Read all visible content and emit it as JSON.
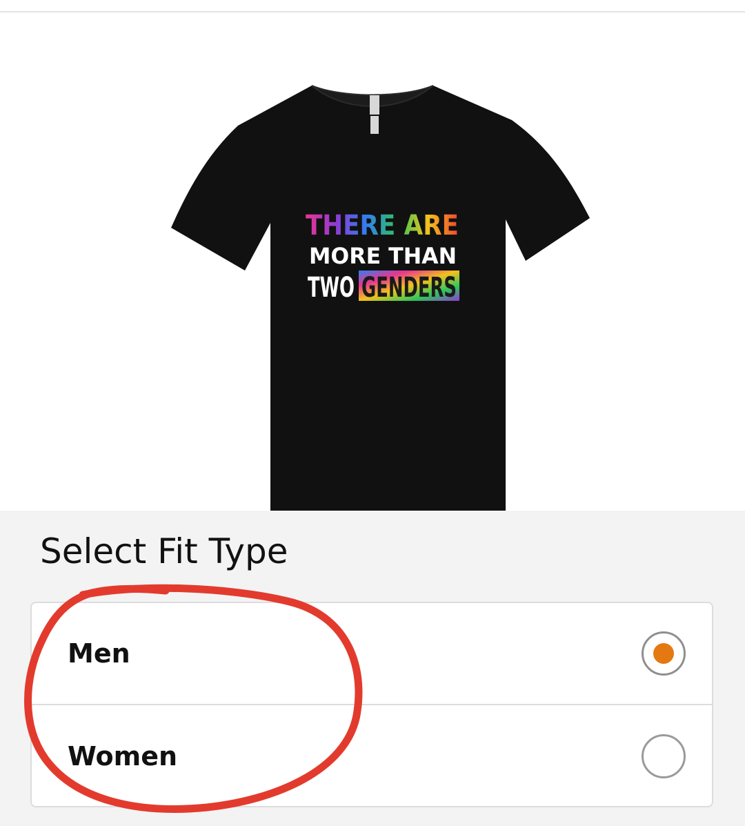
{
  "product": {
    "image_icon": "tshirt-image",
    "shirt_color": "#111111",
    "print_lines": [
      "THERE ARE",
      "MORE THAN",
      "TWO",
      "GENDERS"
    ]
  },
  "fit": {
    "title": "Select Fit Type",
    "options": [
      {
        "label": "Men",
        "selected": true
      },
      {
        "label": "Women",
        "selected": false
      }
    ],
    "accent_color": "#e47911"
  },
  "annotation": {
    "type": "red-circle",
    "color": "#e23b2e"
  }
}
